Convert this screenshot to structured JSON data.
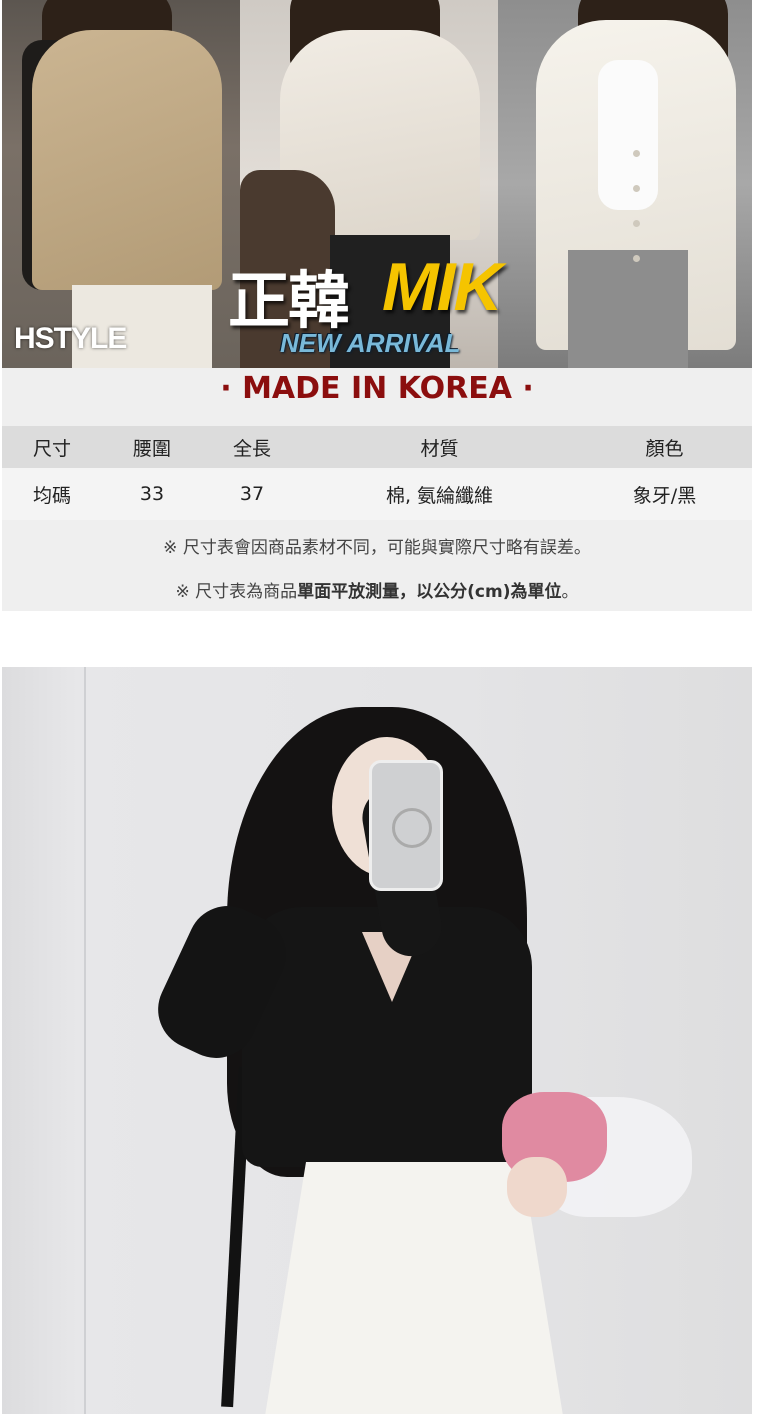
{
  "banner": {
    "brand": "HSTYLE",
    "title_zh": "正韓",
    "title_en": "MIK",
    "subtitle": "NEW ARRIVAL"
  },
  "made_in": "· MADE IN KOREA ·",
  "spec_table": {
    "headers": [
      "尺寸",
      "腰圍",
      "全長",
      "材質",
      "顏色"
    ],
    "row": [
      "均碼",
      "33",
      "37",
      "棉, 氨綸纖維",
      "象牙/黑"
    ]
  },
  "notes": {
    "line1": "※ 尺寸表會因商品素材不同，可能與實際尺寸略有誤差。",
    "line2_prefix": "※ 尺寸表為商品",
    "line2_bold": "單面平放測量，以公分(cm)為單位",
    "line2_suffix": "。"
  },
  "colors": {
    "accent_red": "#8b0e0e",
    "mik_yellow": "#f5c400",
    "new_arrival_blue": "#79b9d9"
  }
}
